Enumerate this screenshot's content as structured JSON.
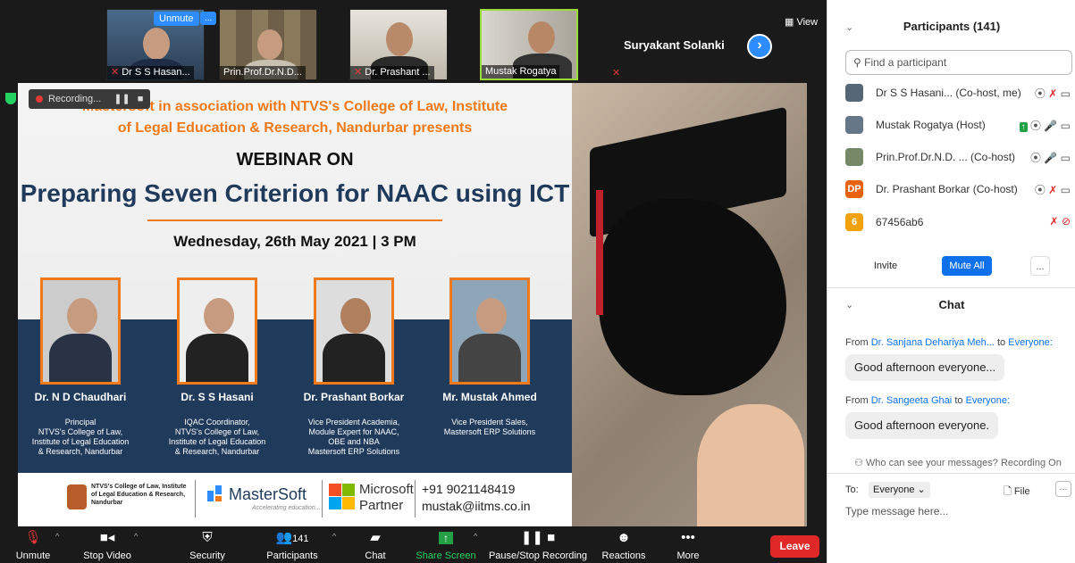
{
  "thumbnails": [
    {
      "name": "Dr S S Hasan...",
      "muted": true
    },
    {
      "name": "Prin.Prof.Dr.N.D...",
      "muted": false
    },
    {
      "name": "Dr. Prashant ...",
      "muted": true
    },
    {
      "name": "Mustak Rogatya",
      "muted": false
    }
  ],
  "popup": {
    "unmute": "Unmute",
    "more": "..."
  },
  "active_speaker": "Suryakant Solanki",
  "view_label": "View",
  "recording_label": "Recording...",
  "poster": {
    "line1": "Mastersoft in association with NTVS's College of Law, Institute",
    "line2": "of Legal Education & Research, Nandurbar presents",
    "line3": "WEBINAR ON",
    "line4": "Preparing Seven Criterion for NAAC using ICT",
    "line5": "Wednesday, 26th May 2021 | 3 PM",
    "speakers": [
      {
        "name": "Dr. N D Chaudhari",
        "desc": "Principal\nNTVS's College of Law,\nInstitute of Legal Education\n& Research, Nandurbar"
      },
      {
        "name": "Dr. S S Hasani",
        "desc": "IQAC Coordinator,\nNTVS's College of Law,\nInstitute of Legal Education\n& Research, Nandurbar"
      },
      {
        "name": "Dr. Prashant Borkar",
        "desc": "Vice President Academia,\nModule Expert for NAAC,\nOBE and NBA\nMastersoft ERP Solutions"
      },
      {
        "name": "Mr. Mustak Ahmed",
        "desc": "Vice President Sales,\nMastersoft ERP Solutions"
      }
    ],
    "footer": {
      "college": "NTVS's College of Law, Institute of Legal Education & Research, Nandurbar",
      "mastersoft": "MasterSoft",
      "mastersoft_tag": "Accelerating education...",
      "microsoft_1": "Microsoft",
      "microsoft_2": "Partner",
      "phone": "+91 9021148419",
      "email": "mustak@iitms.co.in"
    }
  },
  "toolbar": {
    "unmute": "Unmute",
    "stop_video": "Stop Video",
    "security": "Security",
    "participants": "Participants",
    "participants_count": "141",
    "chat": "Chat",
    "share_screen": "Share Screen",
    "pause_recording": "Pause/Stop Recording",
    "reactions": "Reactions",
    "more": "More",
    "leave": "Leave"
  },
  "participants_panel": {
    "title": "Participants (141)",
    "search_placeholder": "Find a participant",
    "list": [
      {
        "initials": "",
        "name": "Dr S S Hasani... (Co-host, me)",
        "color": "#556677"
      },
      {
        "initials": "",
        "name": "Mustak Rogatya (Host)",
        "color": "#667788"
      },
      {
        "initials": "",
        "name": "Prin.Prof.Dr.N.D. ...  (Co-host)",
        "color": "#778866"
      },
      {
        "initials": "DP",
        "name": "Dr. Prashant Borkar (Co-host)",
        "color": "#e8620f"
      },
      {
        "initials": "6",
        "name": "67456ab6",
        "color": "#f2a20c"
      }
    ],
    "invite": "Invite",
    "mute_all": "Mute All",
    "more": "..."
  },
  "chat_panel": {
    "title": "Chat",
    "messages": [
      {
        "from_prefix": "From",
        "sender": "Dr. Sanjana Dehariya Meh...",
        "to_word": "to",
        "recipient": "Everyone:",
        "text": "Good afternoon everyone..."
      },
      {
        "from_prefix": "From",
        "sender": "Dr. Sangeeta Ghai",
        "to_word": "to",
        "recipient": "Everyone:",
        "text": "Good afternoon everyone."
      }
    ],
    "who_can_see": "Who can see your messages? Recording On",
    "to_label": "To:",
    "to_value": "Everyone",
    "file_label": "File",
    "input_placeholder": "Type message here..."
  }
}
